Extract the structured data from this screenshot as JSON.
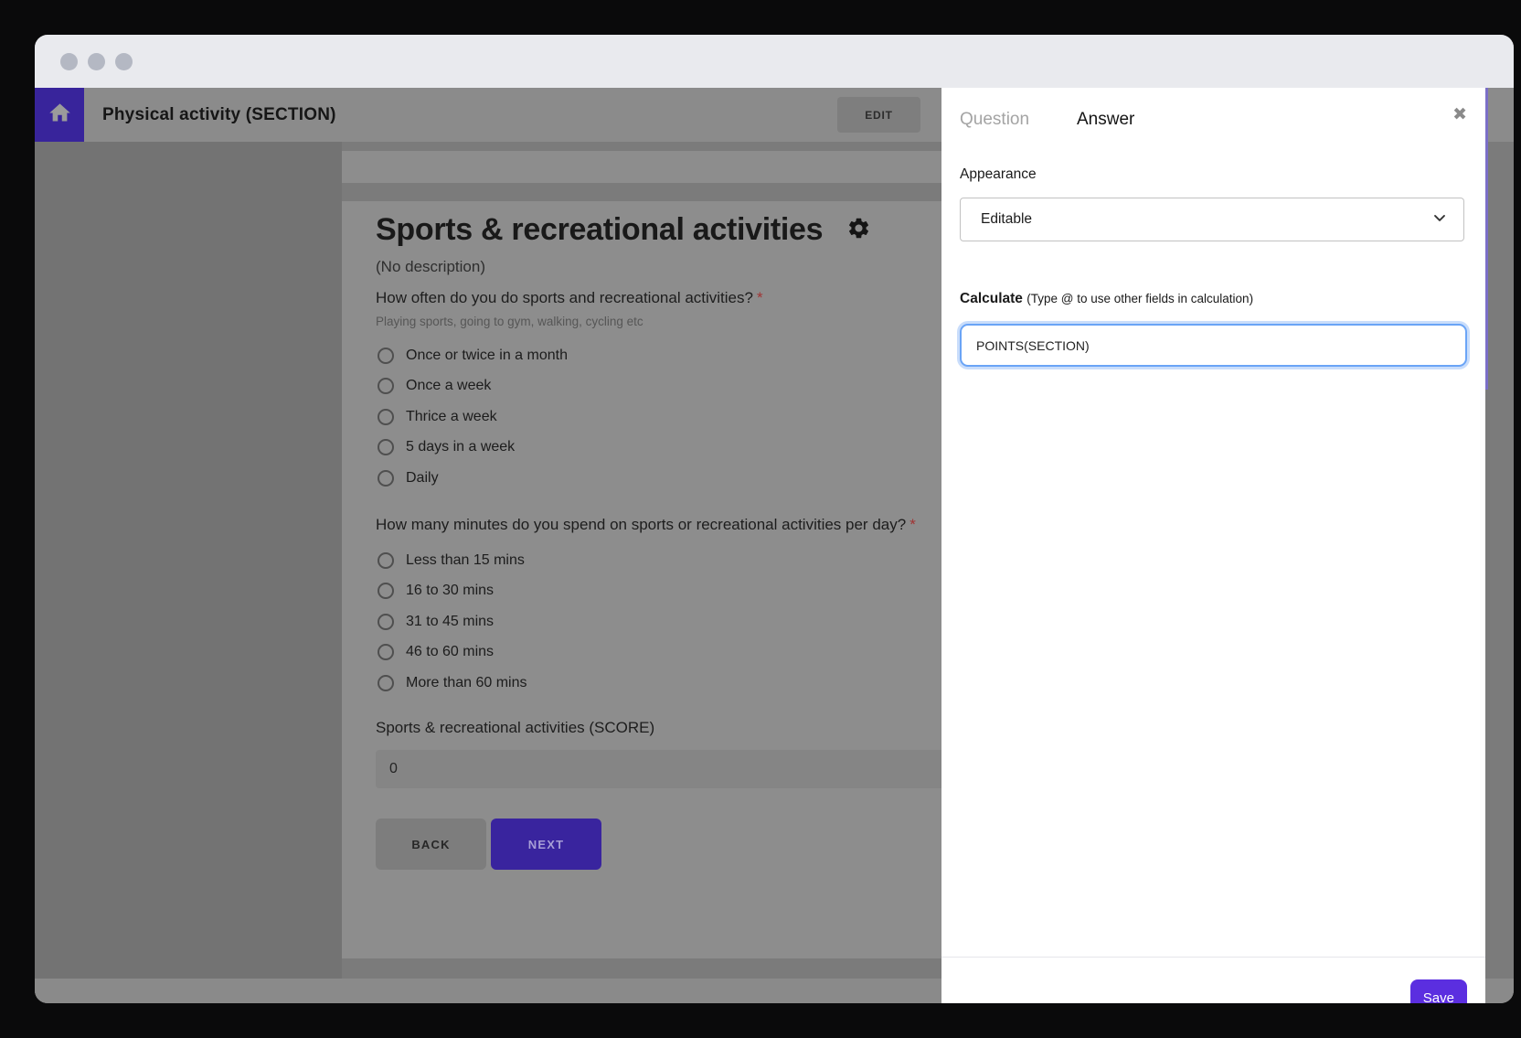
{
  "header": {
    "title": "Physical activity (SECTION)",
    "edit_label": "EDIT"
  },
  "form": {
    "title": "Sports & recreational activities",
    "description": "(No description)",
    "required_marker": "*",
    "questions": [
      {
        "label": "How often do you do sports and recreational activities?",
        "hint": "Playing sports, going to gym, walking, cycling etc",
        "options": [
          "Once or twice in a month",
          "Once a week",
          "Thrice a week",
          "5 days in a week",
          "Daily"
        ]
      },
      {
        "label": "How many minutes do you spend on sports or recreational activities per day?",
        "options": [
          "Less than 15 mins",
          "16 to 30 mins",
          "31 to 45 mins",
          "46 to 60 mins",
          "More than 60 mins"
        ]
      }
    ],
    "score": {
      "label": "Sports & recreational activities (SCORE)",
      "value": "0"
    },
    "back_label": "BACK",
    "next_label": "NEXT"
  },
  "panel": {
    "tabs": {
      "question": "Question",
      "answer": "Answer"
    },
    "close_glyph": "✖",
    "appearance_label": "Appearance",
    "appearance_value": "Editable",
    "calculate_label": "Calculate",
    "calculate_hint": "(Type @ to use other fields in calculation)",
    "calculate_value": "POINTS(SECTION)",
    "save_label": "Save"
  },
  "colors": {
    "accent_purple": "#38249b",
    "save_purple": "#5b2ee0",
    "focus_blue": "#6aa4f6",
    "dim_overlay_gray": "#8d8d8d"
  }
}
